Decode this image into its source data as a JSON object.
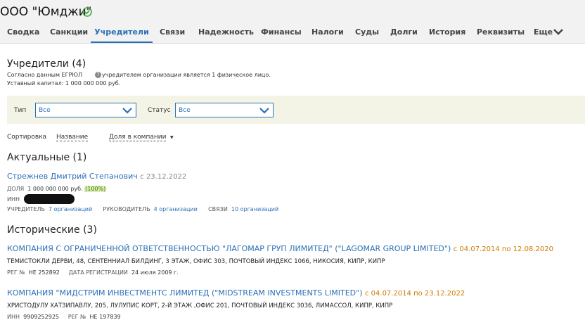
{
  "header": {
    "company_title": "ООО \"Юмджи\"",
    "tabs": [
      {
        "label": "Сводка"
      },
      {
        "label": "Санкции"
      },
      {
        "label": "Учредители",
        "active": true
      },
      {
        "label": "Связи"
      },
      {
        "label": "Надежность"
      },
      {
        "label": "Финансы"
      },
      {
        "label": "Налоги"
      },
      {
        "label": "Суды"
      },
      {
        "label": "Долги"
      },
      {
        "label": "История"
      },
      {
        "label": "Реквизиты"
      },
      {
        "label": "Еще"
      }
    ]
  },
  "founders": {
    "title": "Учредители (4)",
    "egrul_prefix": "Согласно данным ЕГРЮЛ",
    "egrul_suffix": "учредителем организации является 1 физическое лицо.",
    "capital": "Уставный капитал: 1 000 000 000 руб."
  },
  "filters": {
    "type_label": "Тип",
    "type_value": "Все",
    "status_label": "Статус",
    "status_value": "Все"
  },
  "sort": {
    "label": "Сортировка",
    "by_name": "Название",
    "by_share": "Доля в компании"
  },
  "actual": {
    "title": "Актуальные (1)",
    "person": {
      "name": "Стрежнев Дмитрий Степанович",
      "since": "с 23.12.2022",
      "share_label": "ДОЛЯ",
      "share_value": "1 000 000 000 руб.",
      "share_percent": "(100%)",
      "inn_label": "ИНН",
      "founder_label": "УЧРЕДИТЕЛЬ",
      "founder_link": "7 организаций",
      "head_label": "РУКОВОДИТЕЛЬ",
      "head_link": "4 организации",
      "links_label": "СВЯЗИ",
      "links_link": "10 организаций"
    }
  },
  "historical": {
    "title": "Исторические (3)",
    "items": [
      {
        "name": "КОМПАНИЯ С ОГРАНИЧЕННОЙ ОТВЕТСТВЕННОСТЬЮ \"ЛАГОМАР ГРУП ЛИМИТЕД\" (\"LAGOMAR GROUP LIMITED\")",
        "period": "с 04.07.2014 по 12.08.2020",
        "address": "Темистокли Дерви, 48, Сентенниал Билдинг, 3 этаж, офис 303, почтовый индекс 1066, Никосия, Кипр, Кипр",
        "reg_label": "РЕГ №",
        "reg_value": "НЕ 252892",
        "regdate_label": "ДАТА РЕГИСТРАЦИИ",
        "regdate_value": "24 июля 2009 г."
      },
      {
        "name": "КОМПАНИЯ \"МИДСТРИМ ИНВЕСТМЕНТС ЛИМИТЕД (\"MIDSTREAM INVESTMENTS LIMITED\")",
        "period": "с 04.07.2014 по 23.12.2022",
        "address": "Христодулу Хатзипавлу, 205, Лулупис Корт, 2-й этаж ,офис 201, почтовый индекс 3036, Лимассол, Кипр, Кипр",
        "inn_label": "ИНН",
        "inn_value": "9909252925",
        "reg_label": "РЕГ №",
        "reg_value": "НЕ 197839"
      }
    ]
  },
  "colors": {
    "accent": "#2a6fb8",
    "orange": "#d07a00",
    "verified": "#3aa33a"
  }
}
